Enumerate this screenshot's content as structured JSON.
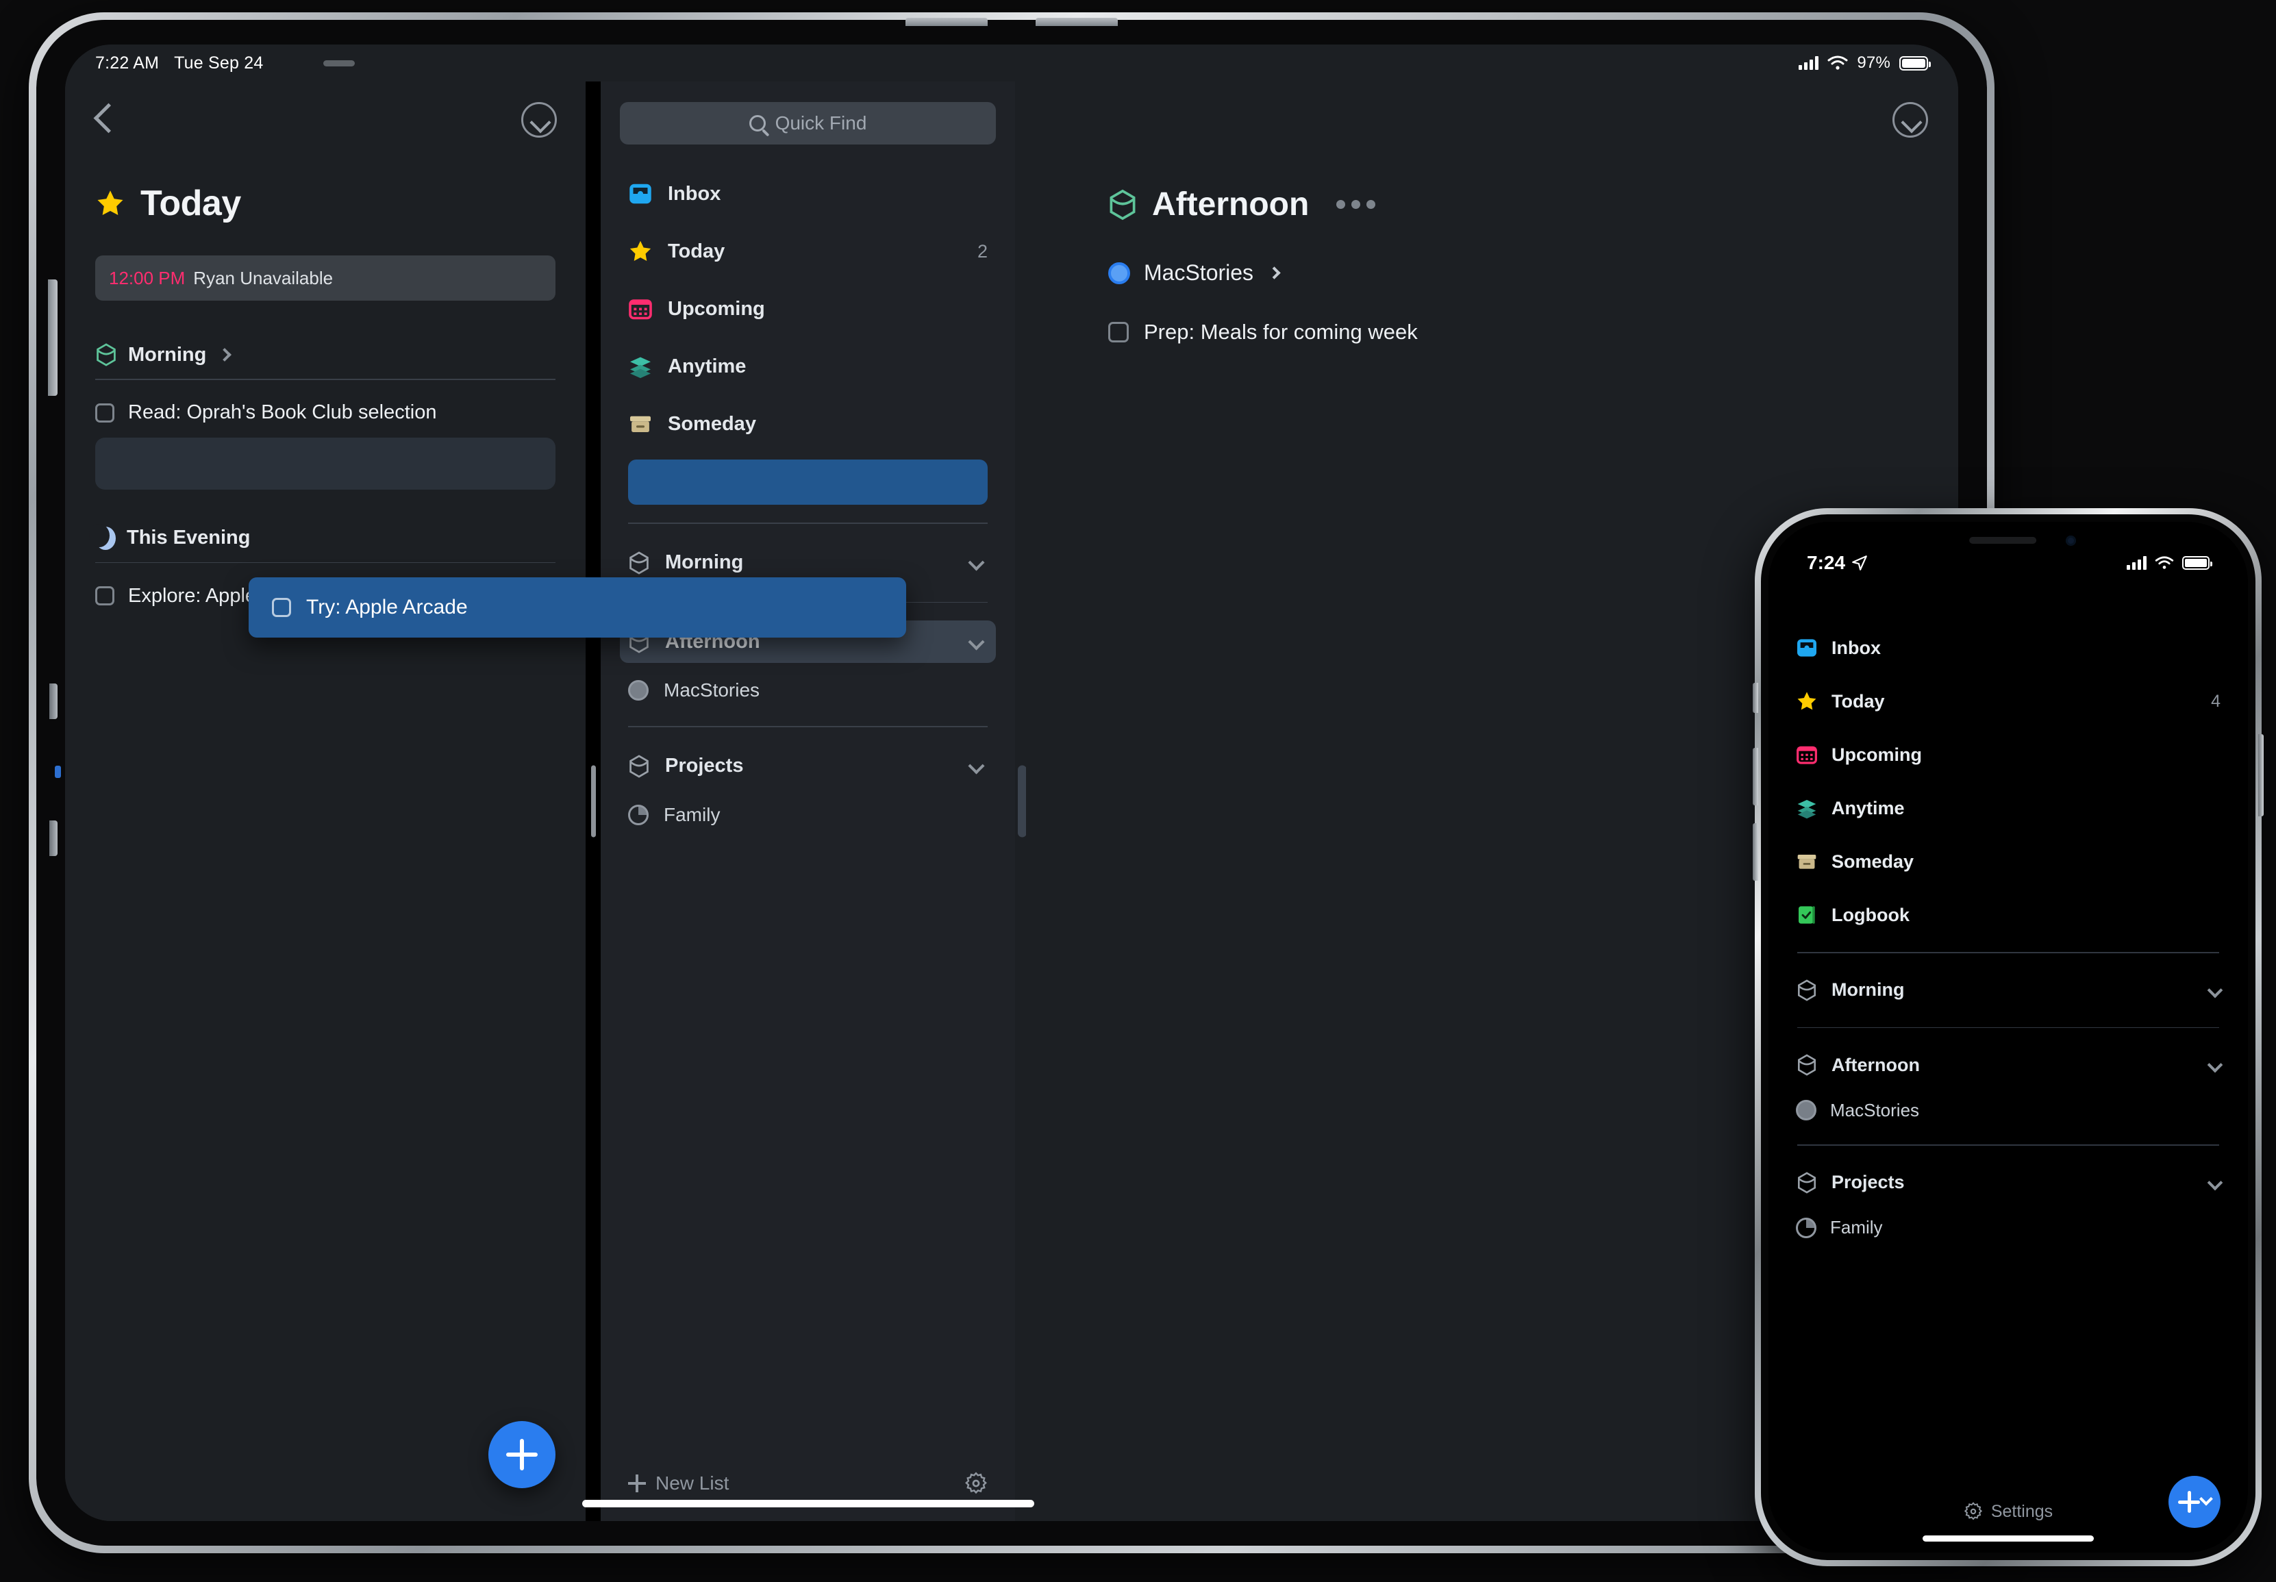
{
  "ipad": {
    "status_bar": {
      "time": "7:22 AM",
      "date": "Tue Sep 24",
      "battery_percent": "97%"
    },
    "today_panel": {
      "title": "Today",
      "title_icon": "star-icon",
      "back_icon": "chevron-left-icon",
      "collapse_icon": "chevron-down-circle-icon",
      "event": {
        "time": "12:00 PM",
        "name": "Ryan Unavailable"
      },
      "sections": [
        {
          "name": "Morning",
          "icon": "heading-hexagon-icon",
          "chevron": "chevron-right-icon",
          "todos": [
            {
              "text": "Read: Oprah's Book Club selection",
              "checked": false
            }
          ]
        },
        {
          "name": "This Evening",
          "icon": "moon-icon",
          "todos": [
            {
              "text": "Explore: Apple service synergy",
              "checked": false
            }
          ]
        }
      ],
      "dragged_item": {
        "text": "Try: Apple Arcade",
        "checked": false
      },
      "add_button": "new-todo-button"
    },
    "sidebar": {
      "search": {
        "placeholder": "Quick Find",
        "icon": "search-icon"
      },
      "items": [
        {
          "label": "Inbox",
          "icon": "inbox-icon",
          "count": ""
        },
        {
          "label": "Today",
          "icon": "star-icon",
          "count": "2"
        },
        {
          "label": "Upcoming",
          "icon": "calendar-icon",
          "count": ""
        },
        {
          "label": "Anytime",
          "icon": "layers-icon",
          "count": ""
        },
        {
          "label": "Someday",
          "icon": "archive-icon",
          "count": ""
        }
      ],
      "drop_target_label": "",
      "groups": [
        {
          "label": "Morning",
          "icon": "heading-hexagon-icon",
          "chevron": "chevron-down-icon",
          "active": false,
          "projects": []
        },
        {
          "label": "Afternoon",
          "icon": "heading-hexagon-icon",
          "chevron": "chevron-down-icon",
          "active": true,
          "projects": [
            {
              "label": "MacStories",
              "icon": "project-circle-icon"
            }
          ]
        },
        {
          "label": "Projects",
          "icon": "heading-hexagon-icon",
          "chevron": "chevron-down-icon",
          "active": false,
          "projects": [
            {
              "label": "Family",
              "icon": "project-pie-icon"
            }
          ]
        }
      ],
      "footer": {
        "new_list": "New List",
        "new_list_icon": "plus-icon",
        "settings_icon": "gear-icon"
      }
    },
    "detail": {
      "title": "Afternoon",
      "title_icon": "heading-hexagon-icon",
      "more_icon": "ellipsis-icon",
      "collapse_icon": "chevron-down-circle-icon",
      "project": {
        "label": "MacStories",
        "icon": "project-circle-blue-icon",
        "chevron": "chevron-right-icon"
      },
      "todos": [
        {
          "text": "Prep: Meals for coming week",
          "checked": false
        }
      ]
    }
  },
  "iphone": {
    "status_bar": {
      "time": "7:24",
      "location_icon": "location-arrow-icon"
    },
    "items": [
      {
        "label": "Inbox",
        "icon": "inbox-icon",
        "count": ""
      },
      {
        "label": "Today",
        "icon": "star-icon",
        "count": "4"
      },
      {
        "label": "Upcoming",
        "icon": "calendar-icon",
        "count": ""
      },
      {
        "label": "Anytime",
        "icon": "layers-icon",
        "count": ""
      },
      {
        "label": "Someday",
        "icon": "archive-icon",
        "count": ""
      },
      {
        "label": "Logbook",
        "icon": "logbook-icon",
        "count": ""
      }
    ],
    "groups": [
      {
        "label": "Morning",
        "icon": "heading-hexagon-icon",
        "chevron": "chevron-down-icon",
        "projects": []
      },
      {
        "label": "Afternoon",
        "icon": "heading-hexagon-icon",
        "chevron": "chevron-down-icon",
        "projects": [
          {
            "label": "MacStories",
            "icon": "project-circle-icon"
          }
        ]
      },
      {
        "label": "Projects",
        "icon": "heading-hexagon-icon",
        "chevron": "chevron-down-icon",
        "projects": [
          {
            "label": "Family",
            "icon": "project-pie-icon"
          }
        ]
      }
    ],
    "footer": {
      "settings": "Settings",
      "settings_icon": "gear-icon",
      "add_icon": "plus-chevron-icon"
    }
  },
  "colors": {
    "accent_blue": "#2a7def",
    "drop_blue": "#22578f",
    "drag_card_blue": "#235a96",
    "star_yellow": "#ffcc00",
    "pink": "#ff2d6f",
    "teal": "#3dbfa6",
    "tan": "#d8c89a",
    "green": "#34c759",
    "inbox_blue": "#1fa7f0",
    "heading_green": "#5ec49a"
  }
}
